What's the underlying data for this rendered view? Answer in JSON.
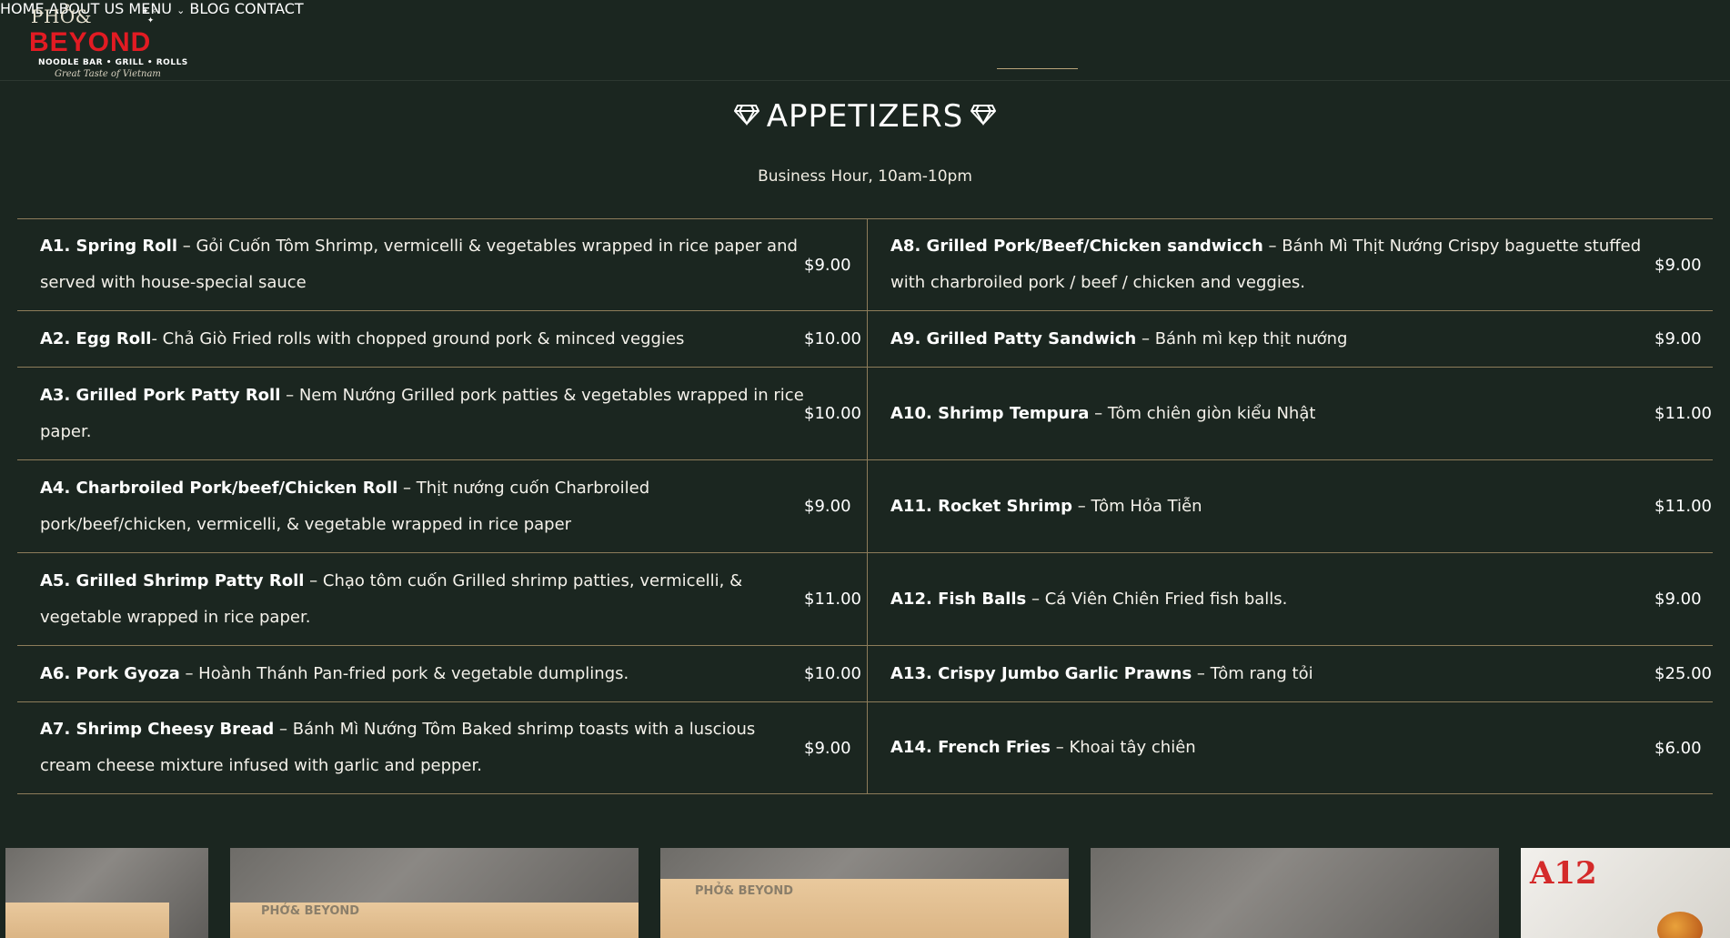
{
  "logo": {
    "line1": "PHỞ&",
    "line2": "BEYOND",
    "sub": "NOODLE BAR • GRILL • ROLLS",
    "tagline": "Great Taste of Vietnam"
  },
  "nav": {
    "home": "HOME",
    "about": "ABOUT US",
    "menu": "MENU",
    "menu_chevron": "chevron-down-icon",
    "blog": "BLOG",
    "contact": "CONTACT"
  },
  "page": {
    "title": "APPETIZERS",
    "title_icon": "diamond-icon",
    "hours": "Business Hour, 10am-10pm"
  },
  "menu": {
    "left": [
      {
        "name": "A1. Spring Roll",
        "desc": " – Gỏi Cuốn Tôm Shrimp, vermicelli & vegetables wrapped in rice paper and served with house-special sauce",
        "price": "$9.00"
      },
      {
        "name": "A2. Egg Roll",
        "desc": "- Chả Giò Fried rolls with chopped ground pork & minced veggies",
        "price": "$10.00"
      },
      {
        "name": "A3. Grilled Pork Patty Roll",
        "desc": " – Nem Nướng Grilled pork patties & vegetables wrapped in rice paper.",
        "price": "$10.00"
      },
      {
        "name": "A4. Charbroiled Pork/beef/Chicken Roll",
        "desc": " – Thịt nướng cuốn Charbroiled pork/beef/chicken, vermicelli, & vegetable wrapped in rice paper",
        "price": "$9.00"
      },
      {
        "name": "A5. Grilled Shrimp Patty Roll",
        "desc": " – Chạo tôm cuốn Grilled shrimp patties, vermicelli, & vegetable wrapped in rice paper.",
        "price": "$11.00"
      },
      {
        "name": "A6. Pork Gyoza",
        "desc": " – Hoành Thánh Pan-fried pork & vegetable dumplings.",
        "price": "$10.00"
      },
      {
        "name": "A7. Shrimp Cheesy Bread",
        "desc": " – Bánh Mì Nướng Tôm Baked shrimp toasts with a luscious cream cheese mixture infused with garlic and pepper.",
        "price": "$9.00"
      }
    ],
    "right": [
      {
        "name": "A8. Grilled Pork/Beef/Chicken sandwicch",
        "desc": " – Bánh Mì Thịt Nướng Crispy baguette stuffed with charbroiled pork / beef / chicken and veggies.",
        "price": "$9.00"
      },
      {
        "name": "A9. Grilled Patty Sandwich",
        "desc": " – Bánh mì kẹp thịt nướng",
        "price": "$9.00"
      },
      {
        "name": "A10. Shrimp Tempura",
        "desc": " – Tôm chiên giòn kiểu Nhật",
        "price": "$11.00"
      },
      {
        "name": "A11. Rocket Shrimp",
        "desc": " – Tôm Hỏa Tiễn",
        "price": "$11.00"
      },
      {
        "name": "A12. Fish Balls",
        "desc": " – Cá Viên Chiên Fried fish balls.",
        "price": "$9.00"
      },
      {
        "name": "A13. Crispy Jumbo Garlic Prawns",
        "desc": " – Tôm rang tỏi",
        "price": "$25.00"
      },
      {
        "name": "A14. French Fries",
        "desc": " – Khoai tây chiên",
        "price": "$6.00"
      }
    ]
  },
  "gallery": {
    "brand": "PHỞ& BEYOND",
    "code": "A12"
  }
}
